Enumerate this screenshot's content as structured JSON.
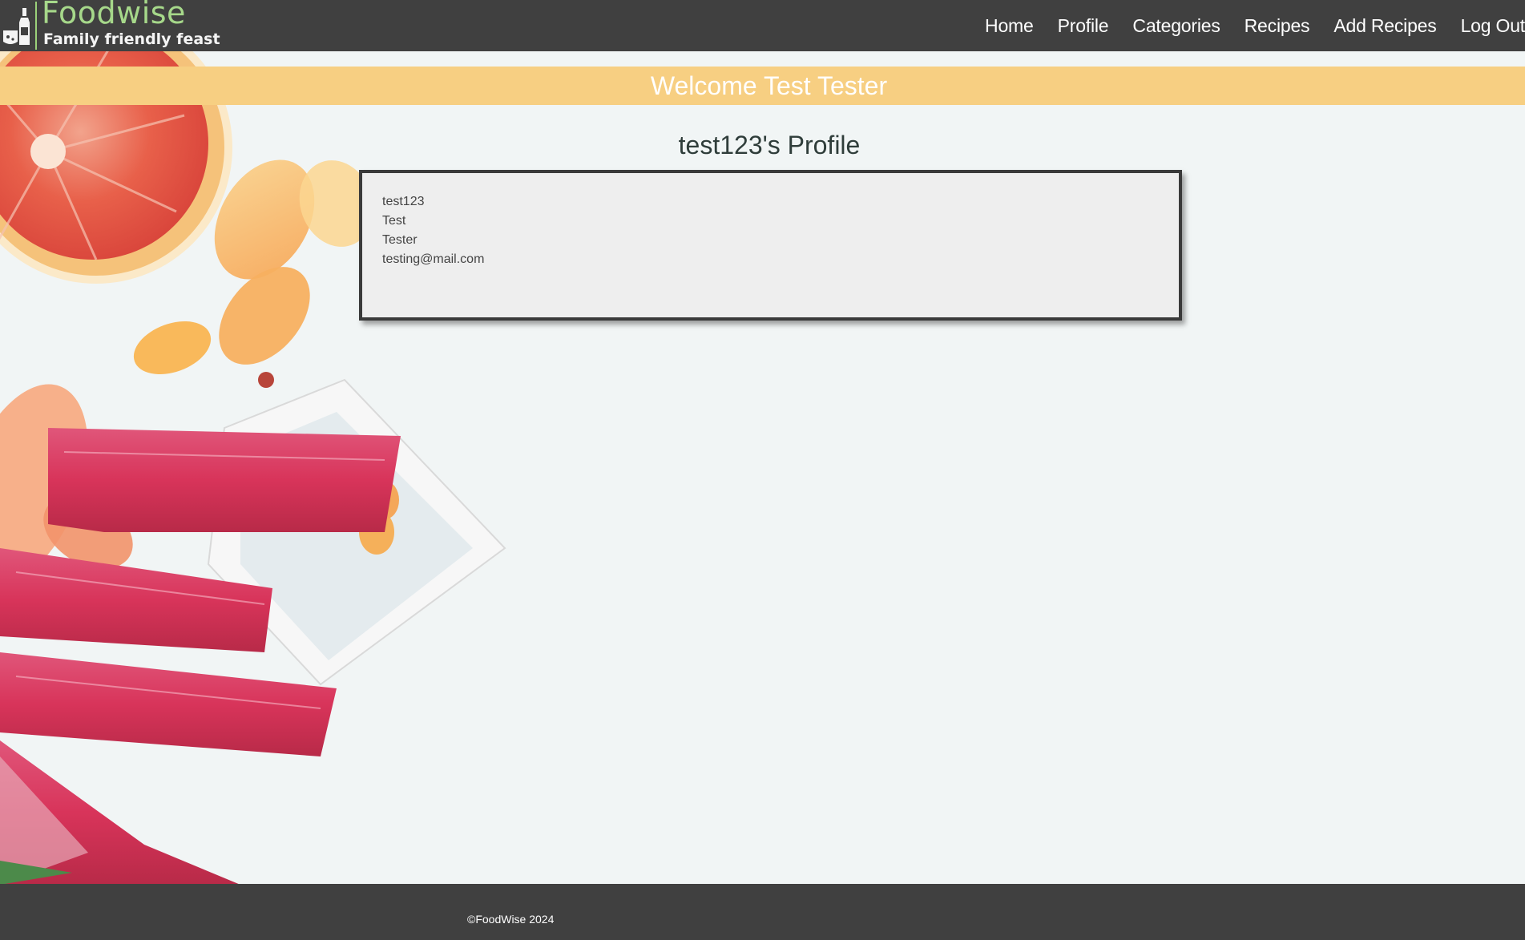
{
  "header": {
    "logo_title": "Foodwise",
    "logo_tagline": "Family friendly feast",
    "logo_icon": "wine-and-cheese-icon",
    "nav": [
      {
        "label": "Home"
      },
      {
        "label": "Profile"
      },
      {
        "label": "Categories"
      },
      {
        "label": "Recipes"
      },
      {
        "label": "Add Recipes"
      },
      {
        "label": "Log Out"
      }
    ]
  },
  "banner": {
    "welcome_text": "Welcome Test Tester"
  },
  "profile": {
    "heading": "test123's Profile",
    "username": "test123",
    "first_name": "Test",
    "last_name": "Tester",
    "email": "testing@mail.com"
  },
  "footer": {
    "copyright": "©FoodWise 2024"
  },
  "colors": {
    "header_bg": "#404040",
    "banner_bg": "#f7cf82",
    "logo_accent": "#a6d88a",
    "card_bg": "#eeeeee",
    "card_border": "#3a3a3a"
  }
}
